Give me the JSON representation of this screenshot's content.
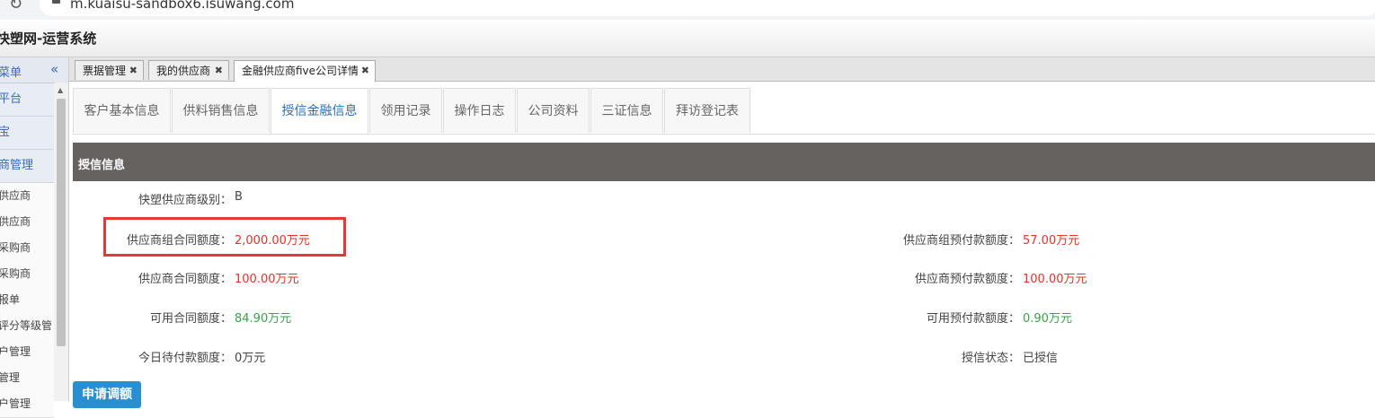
{
  "browser": {
    "url": "m.kuaisu-sandbox6.isuwang.com"
  },
  "app": {
    "title": "快塑网-运营系统"
  },
  "sidebar": {
    "header_label": "菜单",
    "collapse_glyph": "«",
    "items": [
      {
        "label": "平台",
        "kind": "group"
      },
      {
        "label": "宝",
        "kind": "group"
      },
      {
        "label": "商管理",
        "kind": "group"
      },
      {
        "label": "供应商",
        "kind": "sub"
      },
      {
        "label": "供应商",
        "kind": "sub"
      },
      {
        "label": "采购商",
        "kind": "sub"
      },
      {
        "label": "采购商",
        "kind": "sub"
      },
      {
        "label": "报单",
        "kind": "sub"
      },
      {
        "label": "评分等级管",
        "kind": "sub"
      },
      {
        "label": "户管理",
        "kind": "sub"
      },
      {
        "label": "管理",
        "kind": "sub"
      },
      {
        "label": "户管理",
        "kind": "sub"
      }
    ]
  },
  "page_tabs": [
    {
      "label": "票据管理",
      "active": false
    },
    {
      "label": "我的供应商",
      "active": false
    },
    {
      "label": "金融供应商five公司详情",
      "active": true
    }
  ],
  "inner_tabs": [
    {
      "label": "客户基本信息",
      "active": false
    },
    {
      "label": "供料销售信息",
      "active": false
    },
    {
      "label": "授信金融信息",
      "active": true
    },
    {
      "label": "领用记录",
      "active": false
    },
    {
      "label": "操作日志",
      "active": false
    },
    {
      "label": "公司资料",
      "active": false
    },
    {
      "label": "三证信息",
      "active": false
    },
    {
      "label": "拜访登记表",
      "active": false
    }
  ],
  "credit": {
    "section_title": "授信信息",
    "supplier_level": {
      "label": "快塑供应商级别：",
      "value": "B"
    },
    "group_contract_limit": {
      "label": "供应商组合同额度：",
      "value": "2,000.00万元"
    },
    "group_prepay_limit": {
      "label": "供应商组预付款额度：",
      "value": "57.00万元"
    },
    "contract_limit": {
      "label": "供应商合同额度：",
      "value": "100.00万元"
    },
    "prepay_limit": {
      "label": "供应商预付款额度：",
      "value": "100.00万元"
    },
    "available_contract": {
      "label": "可用合同额度：",
      "value": "84.90万元"
    },
    "available_prepay": {
      "label": "可用预付款额度：",
      "value": "0.90万元"
    },
    "today_pending": {
      "label": "今日待付款额度：",
      "value": "0万元"
    },
    "credit_status": {
      "label": "授信状态：",
      "value": "已授信"
    },
    "apply_button": "申请调额"
  },
  "colors": {
    "section_header": "#666260",
    "amount_red": "#e6322a",
    "amount_green": "#3aa34a",
    "highlight": "#e53935",
    "button_blue": "#2a8fd0"
  }
}
